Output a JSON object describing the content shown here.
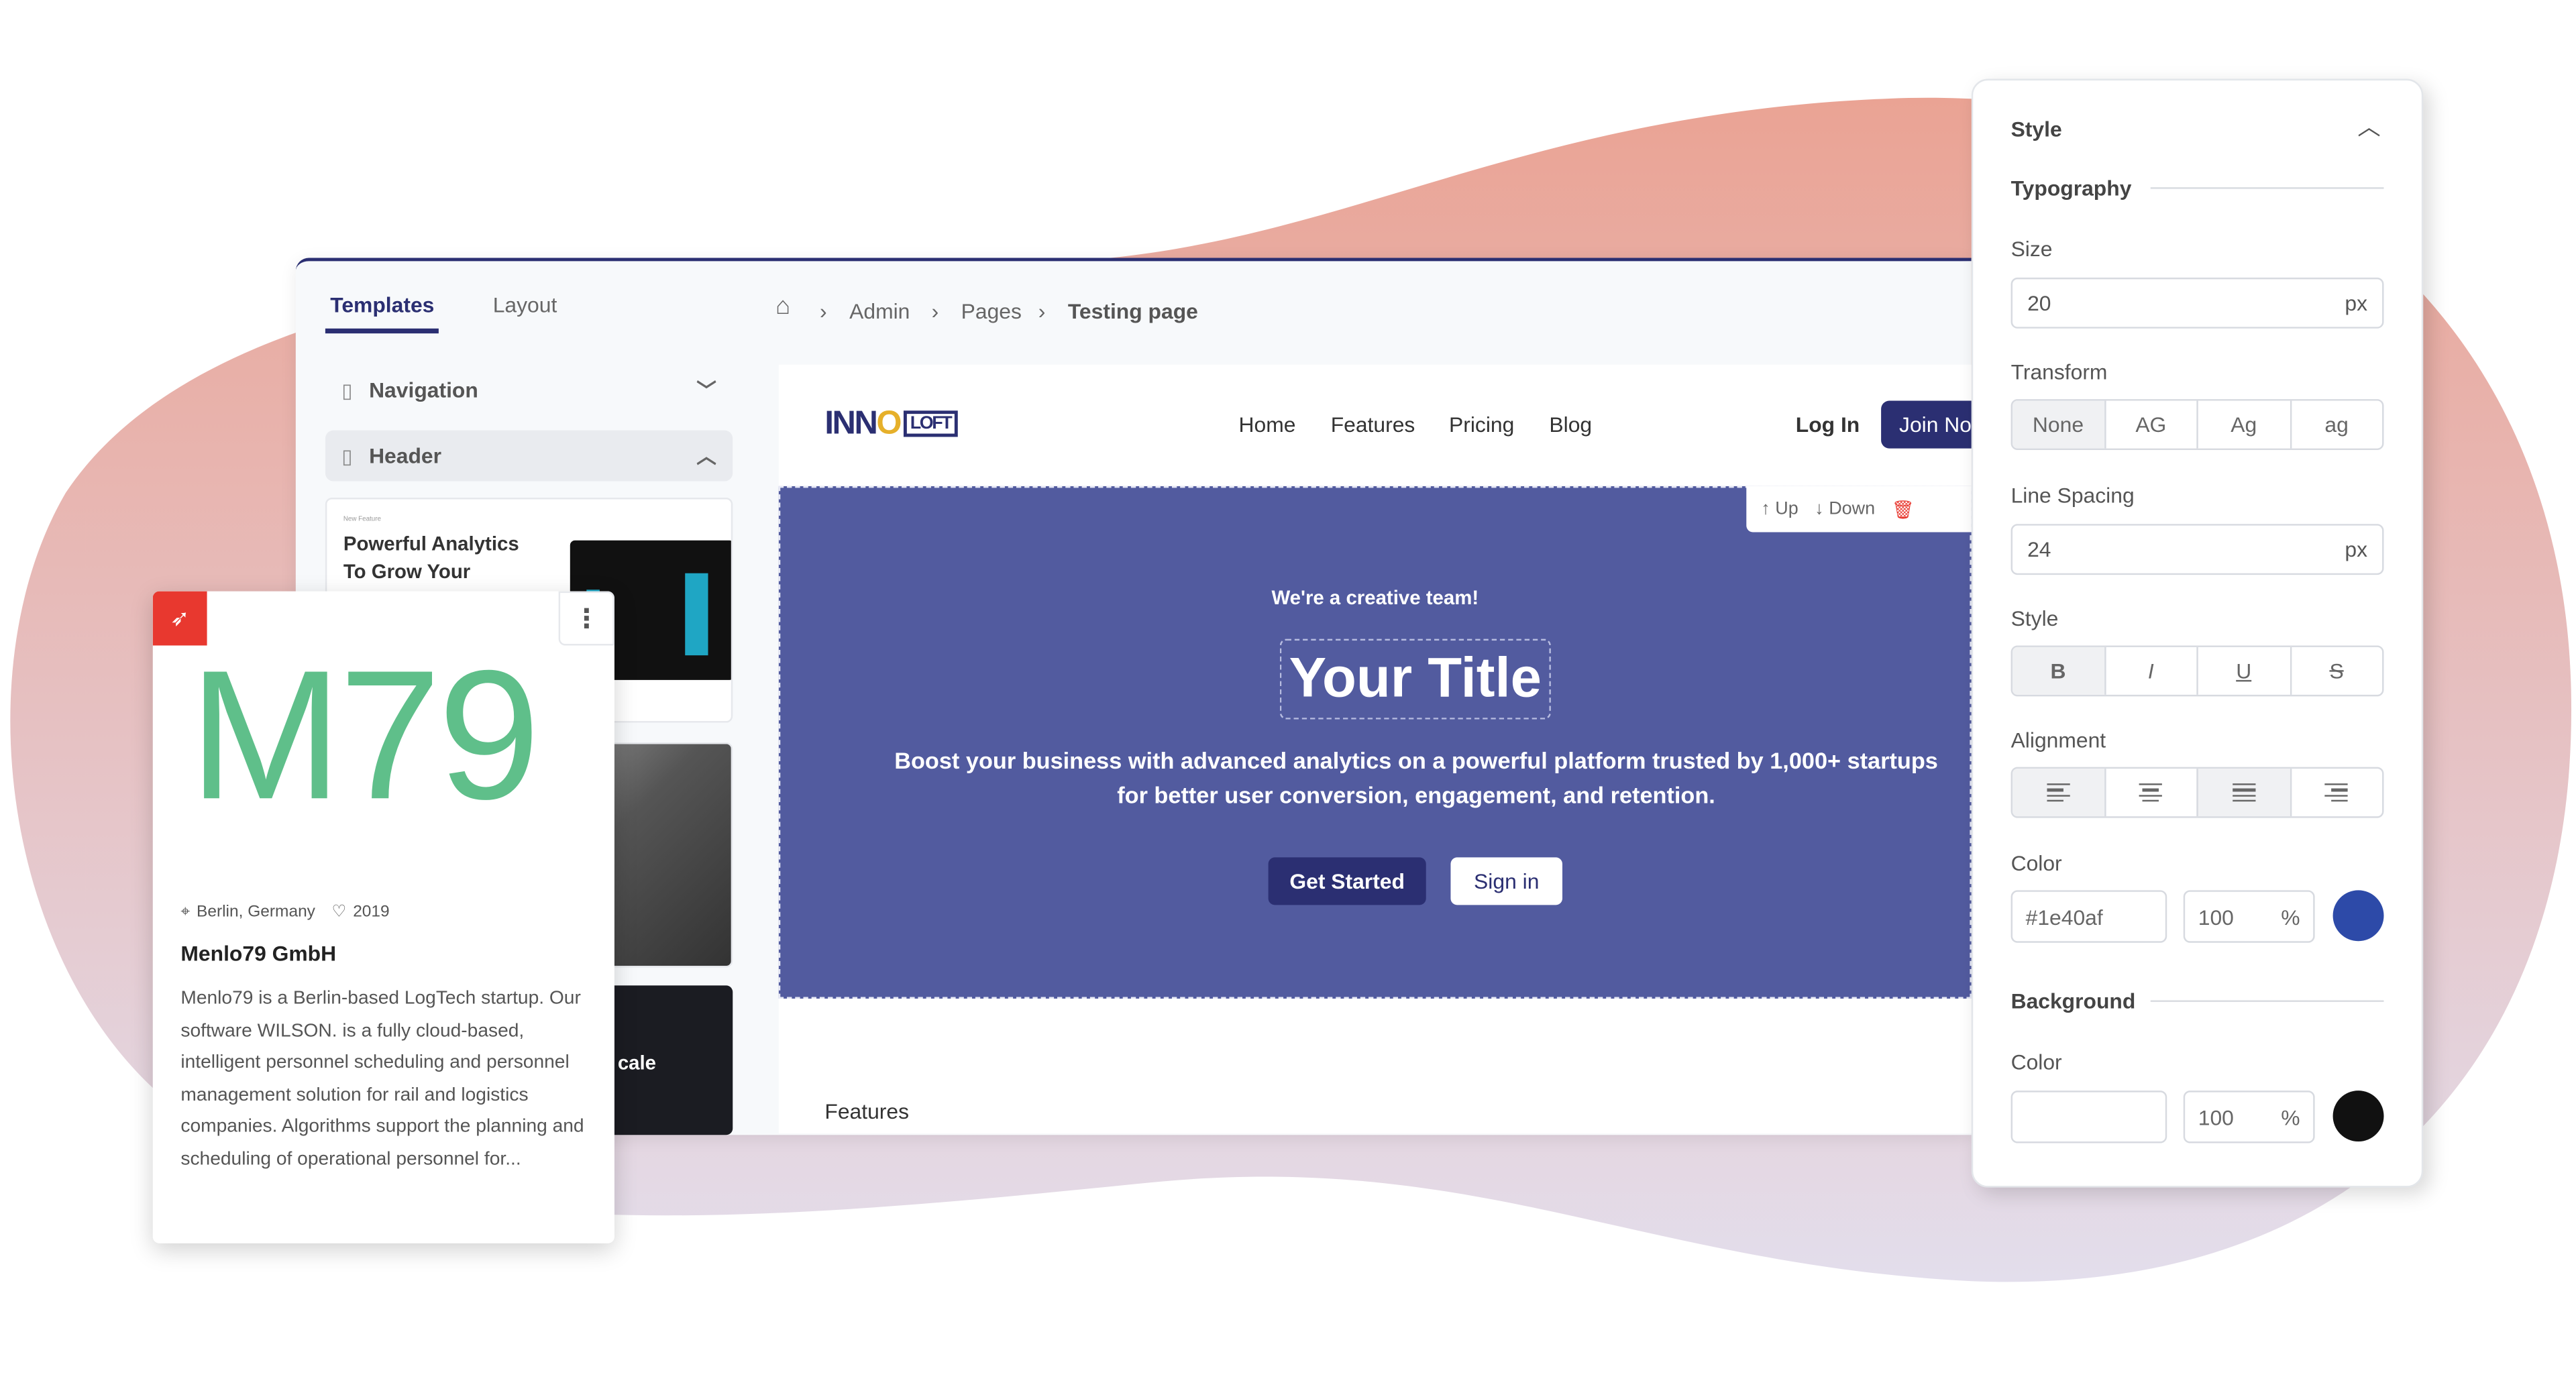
{
  "sidebar": {
    "tabs": [
      "Templates",
      "Layout"
    ],
    "sections": [
      {
        "label": "Navigation",
        "icon": "document-icon",
        "state": "collapsed"
      },
      {
        "label": "Header",
        "icon": "document-icon",
        "state": "expanded"
      }
    ],
    "thumbnails": [
      {
        "kicker": "New Feature",
        "title": "Powerful Analytics To Grow Your"
      },
      {
        "title": ""
      },
      {
        "title": "cale"
      }
    ]
  },
  "breadcrumb": {
    "home_icon": "home-icon",
    "items": [
      "Admin",
      "Pages",
      "Testing page"
    ]
  },
  "preview": {
    "logo": "INNOLOFT",
    "nav": [
      "Home",
      "Features",
      "Pricing",
      "Blog"
    ],
    "login": "Log In",
    "join": "Join Now",
    "toolbar": {
      "up": "Up",
      "down": "Down"
    },
    "hero": {
      "kicker": "We're a creative team!",
      "title": "Your Title",
      "text": "Boost your business with advanced analytics on a powerful platform trusted by 1,000+ startups for better user conversion, engagement, and retention.",
      "primary": "Get Started",
      "secondary": "Sign in"
    },
    "section_label": "Features"
  },
  "company_card": {
    "logo": "M79",
    "location": "Berlin, Germany",
    "founded": "2019",
    "name": "Menlo79 GmbH",
    "description": "Menlo79 is a Berlin-based LogTech startup. Our software WILSON. is a fully cloud-based, intelligent personnel scheduling and personnel management solution for rail and logistics companies. Algorithms support the planning and scheduling of operational personnel for...",
    "accent": "#e8382f",
    "logo_color": "#5fbf8a"
  },
  "style_panel": {
    "title": "Style",
    "typography": "Typography",
    "size_label": "Size",
    "size": "20",
    "unit": "px",
    "transform_label": "Transform",
    "transform": [
      "None",
      "AG",
      "Ag",
      "ag"
    ],
    "transform_selected": "None",
    "line_spacing_label": "Line Spacing",
    "line_spacing": "24",
    "style_label": "Style",
    "styles": [
      "B",
      "I",
      "U",
      "S"
    ],
    "style_selected": "B",
    "alignment_label": "Alignment",
    "alignments": [
      "align-left",
      "align-center",
      "align-justify",
      "align-right"
    ],
    "color_label": "Color",
    "color": "#1e40af",
    "opacity": "100",
    "pct": "%",
    "background": "Background",
    "bg_color_label": "Color",
    "bg_color": "",
    "bg_opacity": "100",
    "bg_swatch": "#111111"
  }
}
